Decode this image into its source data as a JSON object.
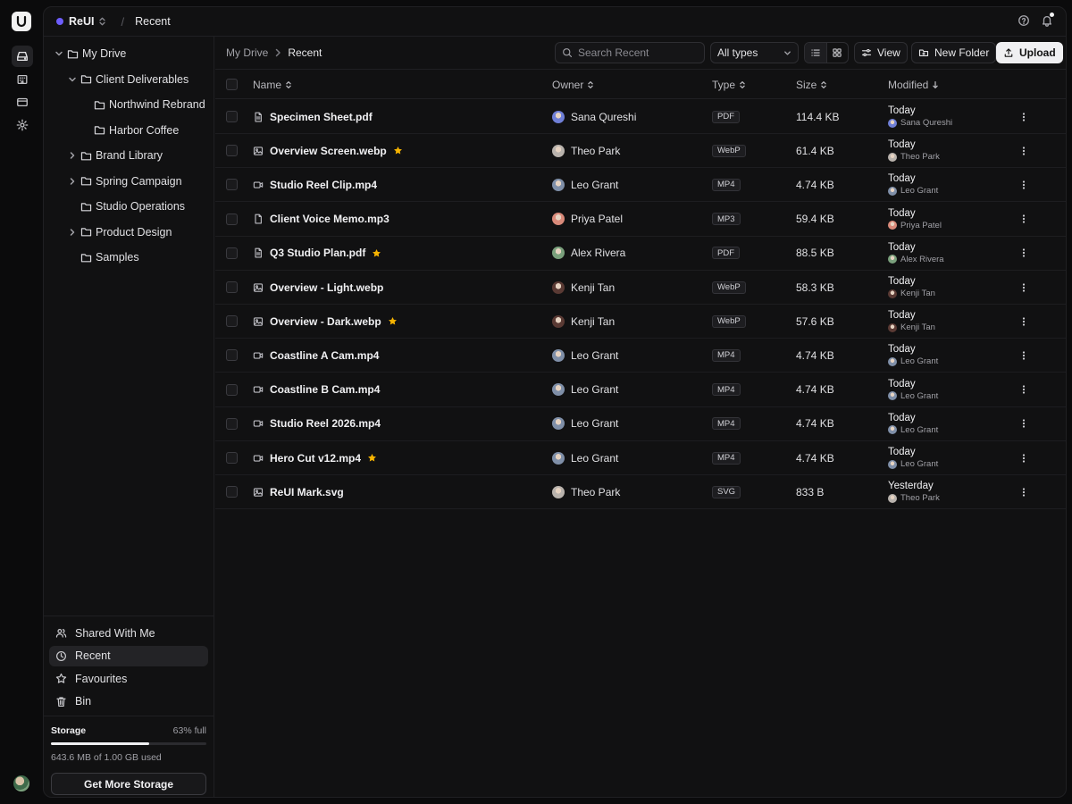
{
  "app": {
    "workspace": "ReUI",
    "crumb": "Recent"
  },
  "sidebar": {
    "tree": [
      {
        "label": "My Drive",
        "level": 0,
        "chevron": "down"
      },
      {
        "label": "Client Deliverables",
        "level": 1,
        "chevron": "down"
      },
      {
        "label": "Northwind Rebrand",
        "level": 2,
        "chevron": ""
      },
      {
        "label": "Harbor Coffee",
        "level": 2,
        "chevron": ""
      },
      {
        "label": "Brand Library",
        "level": 1,
        "chevron": "right"
      },
      {
        "label": "Spring Campaign",
        "level": 1,
        "chevron": "right"
      },
      {
        "label": "Studio Operations",
        "level": 1,
        "chevron": ""
      },
      {
        "label": "Product Design",
        "level": 1,
        "chevron": "right"
      },
      {
        "label": "Samples",
        "level": 1,
        "chevron": ""
      }
    ],
    "nav": [
      {
        "label": "Shared With Me",
        "icon": "users-icon",
        "active": false
      },
      {
        "label": "Recent",
        "icon": "clock-icon",
        "active": true
      },
      {
        "label": "Favourites",
        "icon": "star-icon",
        "active": false
      },
      {
        "label": "Bin",
        "icon": "trash-icon",
        "active": false
      }
    ],
    "storage": {
      "title": "Storage",
      "percent_text": "63% full",
      "used_fraction": 0.63,
      "used_text": "643.6 MB of 1.00 GB used",
      "button": "Get More Storage"
    }
  },
  "toolbar": {
    "crumb_root": "My Drive",
    "crumb_current": "Recent",
    "search_placeholder": "Search Recent",
    "type_filter": "All types",
    "view_label": "View",
    "new_folder_label": "New Folder",
    "upload_label": "Upload"
  },
  "table": {
    "headers": {
      "name": "Name",
      "owner": "Owner",
      "type": "Type",
      "size": "Size",
      "modified": "Modified"
    },
    "rows": [
      {
        "name": "Specimen Sheet.pdf",
        "icon": "document-icon",
        "starred": false,
        "owner": "Sana Qureshi",
        "owner_color": "#6f7fd6",
        "type": "PDF",
        "size": "114.4 KB",
        "modified": "Today"
      },
      {
        "name": "Overview Screen.webp",
        "icon": "image-icon",
        "starred": true,
        "owner": "Theo Park",
        "owner_color": "#b9b3ad",
        "type": "WebP",
        "size": "61.4 KB",
        "modified": "Today"
      },
      {
        "name": "Studio Reel Clip.mp4",
        "icon": "video-icon",
        "starred": false,
        "owner": "Leo Grant",
        "owner_color": "#7f8fa8",
        "type": "MP4",
        "size": "4.74 KB",
        "modified": "Today"
      },
      {
        "name": "Client Voice Memo.mp3",
        "icon": "file-icon",
        "starred": false,
        "owner": "Priya Patel",
        "owner_color": "#d98a7a",
        "type": "MP3",
        "size": "59.4 KB",
        "modified": "Today"
      },
      {
        "name": "Q3 Studio Plan.pdf",
        "icon": "document-icon",
        "starred": true,
        "owner": "Alex Rivera",
        "owner_color": "#7aa07c",
        "type": "PDF",
        "size": "88.5 KB",
        "modified": "Today"
      },
      {
        "name": "Overview - Light.webp",
        "icon": "image-icon",
        "starred": false,
        "owner": "Kenji Tan",
        "owner_color": "#5a3a34",
        "type": "WebP",
        "size": "58.3 KB",
        "modified": "Today"
      },
      {
        "name": "Overview - Dark.webp",
        "icon": "image-icon",
        "starred": true,
        "owner": "Kenji Tan",
        "owner_color": "#5a3a34",
        "type": "WebP",
        "size": "57.6 KB",
        "modified": "Today"
      },
      {
        "name": "Coastline A Cam.mp4",
        "icon": "video-icon",
        "starred": false,
        "owner": "Leo Grant",
        "owner_color": "#7f8fa8",
        "type": "MP4",
        "size": "4.74 KB",
        "modified": "Today"
      },
      {
        "name": "Coastline B Cam.mp4",
        "icon": "video-icon",
        "starred": false,
        "owner": "Leo Grant",
        "owner_color": "#7f8fa8",
        "type": "MP4",
        "size": "4.74 KB",
        "modified": "Today"
      },
      {
        "name": "Studio Reel 2026.mp4",
        "icon": "video-icon",
        "starred": false,
        "owner": "Leo Grant",
        "owner_color": "#7f8fa8",
        "type": "MP4",
        "size": "4.74 KB",
        "modified": "Today"
      },
      {
        "name": "Hero Cut v12.mp4",
        "icon": "video-icon",
        "starred": true,
        "owner": "Leo Grant",
        "owner_color": "#7f8fa8",
        "type": "MP4",
        "size": "4.74 KB",
        "modified": "Today"
      },
      {
        "name": "ReUI Mark.svg",
        "icon": "image-icon",
        "starred": false,
        "owner": "Theo Park",
        "owner_color": "#b9b3ad",
        "type": "SVG",
        "size": "833 B",
        "modified": "Yesterday"
      }
    ]
  },
  "colors": {
    "accent": "#6d5dfc",
    "star": "#f5b301",
    "background": "#111112"
  }
}
